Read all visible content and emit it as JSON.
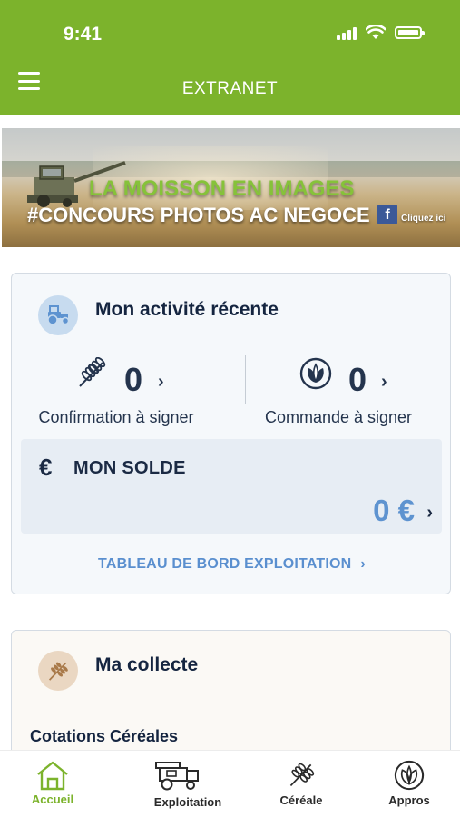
{
  "status_bar": {
    "time": "9:41"
  },
  "header": {
    "title": "EXTRANET",
    "menu_icon": "hamburger-menu-icon"
  },
  "banner": {
    "line1": "LA MOISSON EN IMAGES",
    "line2": "#CONCOURS PHOTOS AC NEGOCE",
    "facebook_letter": "f",
    "cta": "Cliquez ici"
  },
  "activity": {
    "title": "Mon activité récente",
    "icon": "tractor-icon",
    "confirmation": {
      "count": "0",
      "label": "Confirmation à signer",
      "icon": "wheat-icon"
    },
    "commande": {
      "count": "0",
      "label": "Commande à signer",
      "icon": "leaf-circle-icon"
    },
    "solde": {
      "symbol": "€",
      "label": "MON SOLDE",
      "value": "0 €"
    },
    "dashboard_link": "TABLEAU DE BORD EXPLOITATION"
  },
  "collecte": {
    "title": "Ma collecte",
    "icon": "wheat-icon",
    "subtitle": "Cotations Céréales"
  },
  "tabbar": {
    "items": [
      {
        "label": "Accueil",
        "icon": "home-icon",
        "active": true
      },
      {
        "label": "Exploitation",
        "icon": "harvester-icon",
        "active": false
      },
      {
        "label": "Céréale",
        "icon": "wheat-icon",
        "active": false
      },
      {
        "label": "Appros",
        "icon": "leaf-circle-icon",
        "active": false
      }
    ]
  },
  "colors": {
    "brand_green": "#7cb32c",
    "link_blue": "#5a8fcf",
    "value_blue": "#5e93d0",
    "navy": "#152540"
  }
}
